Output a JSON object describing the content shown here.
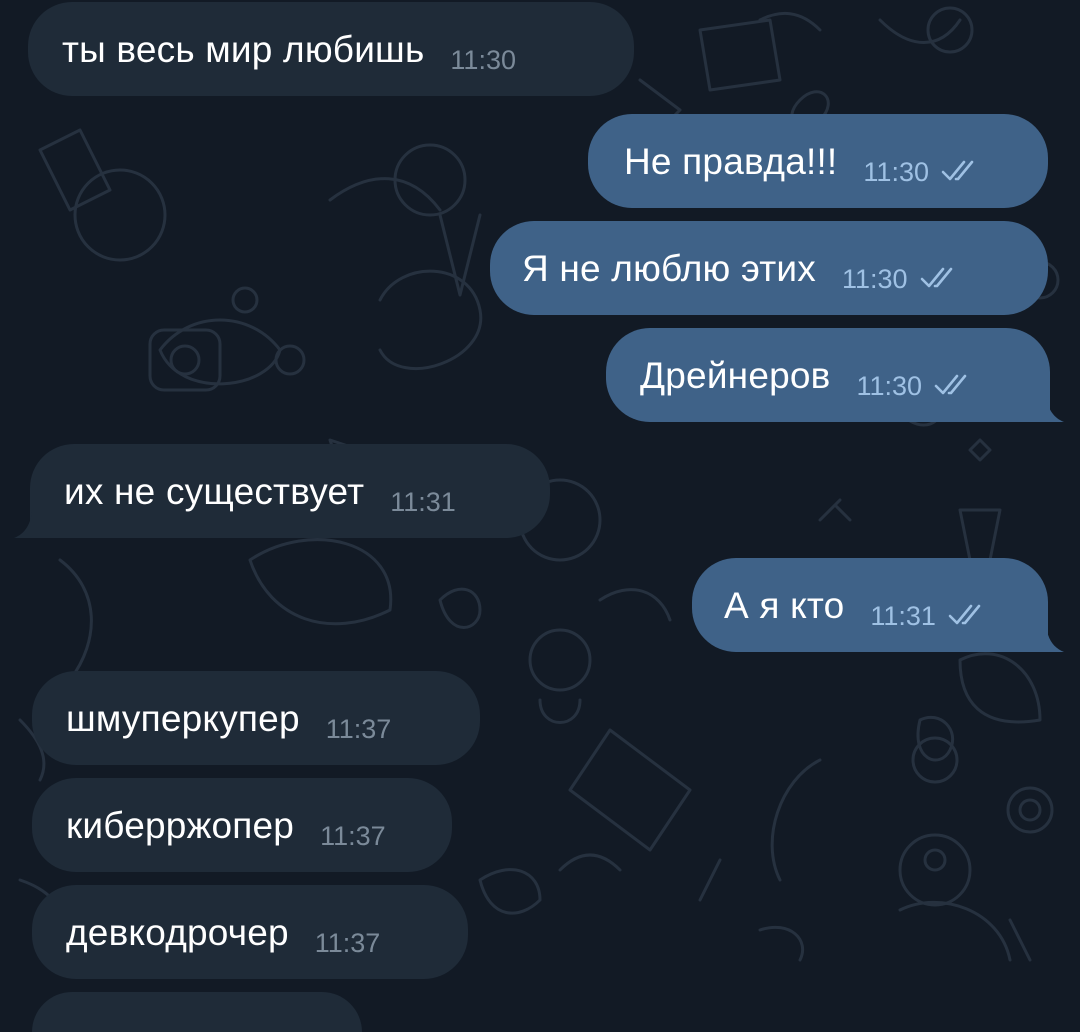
{
  "chat": {
    "messages": [
      {
        "direction": "incoming",
        "text": "ты весь мир любишь",
        "time": "11:30"
      },
      {
        "direction": "outgoing",
        "text": "Не правда!!!",
        "time": "11:30",
        "status": "read"
      },
      {
        "direction": "outgoing",
        "text": "Я не люблю этих",
        "time": "11:30",
        "status": "read"
      },
      {
        "direction": "outgoing",
        "text": "Дрейнеров",
        "time": "11:30",
        "status": "read"
      },
      {
        "direction": "incoming",
        "text": "их не существует",
        "time": "11:31"
      },
      {
        "direction": "outgoing",
        "text": "А я кто",
        "time": "11:31",
        "status": "read"
      },
      {
        "direction": "incoming",
        "text": "шмуперкупер",
        "time": "11:37"
      },
      {
        "direction": "incoming",
        "text": "киберржопер",
        "time": "11:37"
      },
      {
        "direction": "incoming",
        "text": "девкодрочер",
        "time": "11:37"
      }
    ]
  },
  "icons": {
    "read_status": "double-check-icon"
  },
  "colors": {
    "background": "#121a25",
    "incoming_bubble": "#1f2b38",
    "outgoing_bubble": "#3f6288",
    "incoming_time": "#7b8a99",
    "outgoing_time": "#9fc1e4",
    "text": "#ffffff"
  }
}
